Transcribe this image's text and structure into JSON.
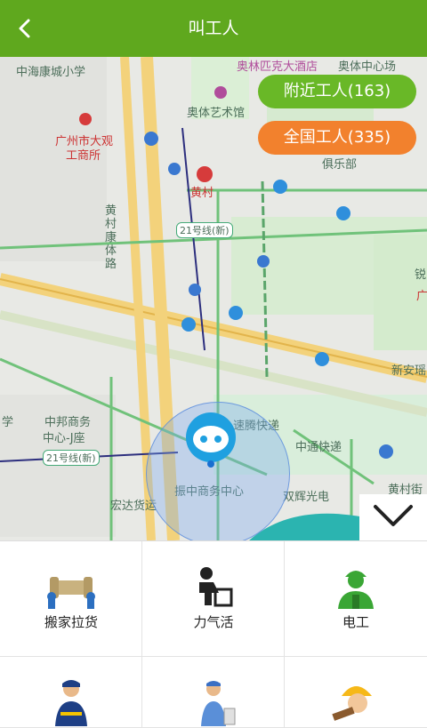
{
  "header": {
    "title": "叫工人",
    "back_icon": "back-arrow-icon"
  },
  "map": {
    "labels": [
      "中海康城小学",
      "奥林匹克大酒店",
      "奥体中心场",
      "奥体艺术馆",
      "广州市大观",
      "工商所",
      "俱乐部",
      "黄村",
      "黄村康体路",
      "21号线(新)",
      "中邦商务",
      "中心-J座",
      "21号线(新)",
      "速腾快递",
      "中通快递",
      "振中商务中心",
      "双辉光电",
      "宏达货运",
      "新安瑶",
      "黄村街",
      "学",
      "锐",
      "广"
    ],
    "nearby_workers": "附近工人(163)",
    "national_workers": "全国工人(335)"
  },
  "colors": {
    "accent": "#5fa81e",
    "orange": "#f2812d",
    "pill_green": "#69b827"
  },
  "categories": [
    {
      "label": "搬家拉货",
      "icon": "moving-furniture-icon"
    },
    {
      "label": "力气活",
      "icon": "manual-labor-icon"
    },
    {
      "label": "电工",
      "icon": "electrician-icon"
    },
    {
      "label": "",
      "icon": "worker-icon"
    },
    {
      "label": "",
      "icon": "plumber-icon"
    },
    {
      "label": "",
      "icon": "construction-worker-icon"
    }
  ]
}
